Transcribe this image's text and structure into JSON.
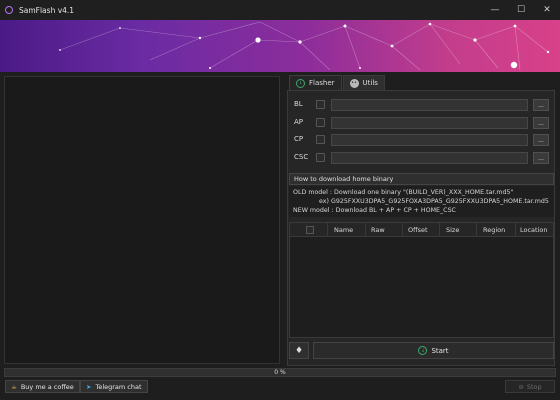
{
  "window": {
    "title": "SamFlash v4.1",
    "minimize_glyph": "—",
    "maximize_glyph": "☐",
    "close_glyph": "✕"
  },
  "tabs": [
    {
      "label": "Flasher",
      "icon": "flasher-icon",
      "active": true
    },
    {
      "label": "Utils",
      "icon": "utils-icon",
      "active": false
    }
  ],
  "files": [
    {
      "label": "BL",
      "value": "",
      "browse": "..."
    },
    {
      "label": "AP",
      "value": "",
      "browse": "..."
    },
    {
      "label": "CP",
      "value": "",
      "browse": "..."
    },
    {
      "label": "CSC",
      "value": "",
      "browse": "..."
    }
  ],
  "howto": {
    "header": "How to download home binary",
    "line1": "OLD model : Download one binary \"(BUILD_VER)_XXX_HOME.tar.md5\"",
    "line2": "             ex) G925FXXU3DPA5_G925FOXA3DPA5_G925FXXU3DPA5_HOME.tar.md5",
    "line3": "NEW model : Download BL + AP + CP + HOME_CSC"
  },
  "table": {
    "columns": [
      "Name",
      "Raw",
      "Offset",
      "Size",
      "Region",
      "Location"
    ]
  },
  "actions": {
    "start_label": "Start"
  },
  "progress": {
    "value": 0,
    "text": "0 %"
  },
  "bottom": {
    "coffee_label": "Buy me a coffee",
    "telegram_label": "Telegram chat",
    "stop_label": "Stop"
  },
  "colors": {
    "accent_purple": "#b873f0",
    "start_green": "#3fa86b",
    "banner_left": "#4b1a86",
    "banner_right": "#d9418a"
  }
}
